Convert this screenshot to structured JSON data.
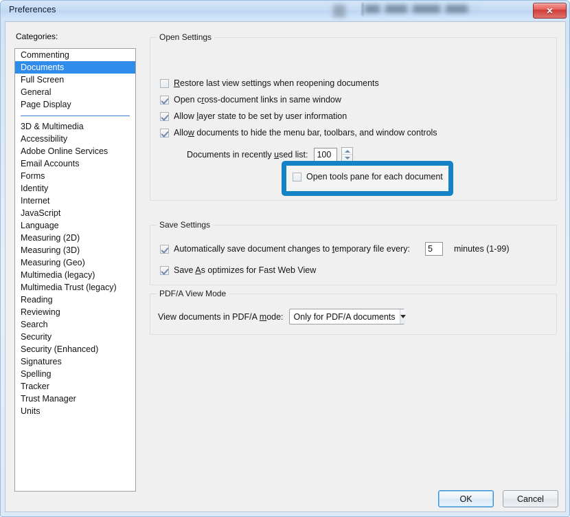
{
  "window": {
    "title": "Preferences",
    "close_label": "✕",
    "obscured_note": ""
  },
  "categories": {
    "label": "Categories:",
    "selected": "Documents",
    "items_top": [
      "Commenting",
      "Documents",
      "Full Screen",
      "General",
      "Page Display"
    ],
    "items_bottom": [
      "3D & Multimedia",
      "Accessibility",
      "Adobe Online Services",
      "Email Accounts",
      "Forms",
      "Identity",
      "Internet",
      "JavaScript",
      "Language",
      "Measuring (2D)",
      "Measuring (3D)",
      "Measuring (Geo)",
      "Multimedia (legacy)",
      "Multimedia Trust (legacy)",
      "Reading",
      "Reviewing",
      "Search",
      "Security",
      "Security (Enhanced)",
      "Signatures",
      "Spelling",
      "Tracker",
      "Trust Manager",
      "Units"
    ]
  },
  "open_settings": {
    "title": "Open Settings",
    "restore_view": {
      "pre": "",
      "acc": "R",
      "post": "estore last view settings when reopening documents",
      "checked": false
    },
    "cross_document": {
      "pre": "Open c",
      "acc": "r",
      "post": "oss-document links in same window",
      "checked": true
    },
    "layer_state": {
      "pre": "Allow ",
      "acc": "l",
      "post": "ayer state to be set by user information",
      "checked": true
    },
    "hide_menu_bar": {
      "pre": "Allo",
      "acc": "w",
      "post": " documents to hide the menu bar, toolbars, and window controls",
      "checked": true
    },
    "recent_list": {
      "pre": "Documents in recently ",
      "acc": "u",
      "post": "sed list:",
      "value": "100"
    },
    "tools_pane": {
      "pre": "Open tools pane for each document",
      "acc": "",
      "post": "",
      "checked": false
    }
  },
  "save_settings": {
    "title": "Save Settings",
    "autosave": {
      "pre": "Automatically save document changes to ",
      "acc": "t",
      "post": "emporary file every:",
      "checked": true,
      "value": "5",
      "units": "minutes (1-99)"
    },
    "fast_web_view": {
      "pre": "Save ",
      "acc": "A",
      "post": "s optimizes for Fast Web View",
      "checked": true
    }
  },
  "pdfa_view_mode": {
    "title": "PDF/A View Mode",
    "label_pre": "View documents in PDF/A ",
    "label_acc": "m",
    "label_post": "ode:",
    "selected": "Only for PDF/A documents"
  },
  "buttons": {
    "ok": "OK",
    "cancel": "Cancel"
  },
  "colors": {
    "selection": "#2f8ceb",
    "highlight": "#1383c6",
    "dialog_bg": "#f0f0f0"
  }
}
